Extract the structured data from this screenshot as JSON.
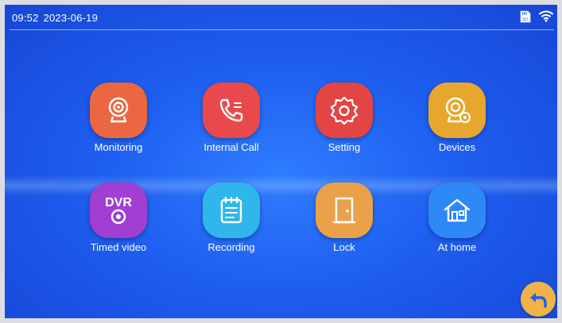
{
  "status": {
    "time": "09:52",
    "date": "2023-06-19",
    "icons": [
      "sd-card-icon",
      "wifi-icon"
    ]
  },
  "colors": {
    "screen_bg": "#1e5ff0",
    "monitoring": "#ea6742",
    "internal_call": "#e9494a",
    "setting": "#e34444",
    "devices": "#e6a72c",
    "timed_video": "#a03fd1",
    "recording": "#2fb6ea",
    "lock": "#e9a24a",
    "at_home": "#2e88f5",
    "back": "#f1b347"
  },
  "menu": [
    {
      "label": "Monitoring",
      "icon": "camera-icon"
    },
    {
      "label": "Internal Call",
      "icon": "phone-icon"
    },
    {
      "label": "Setting",
      "icon": "gear-icon"
    },
    {
      "label": "Devices",
      "icon": "device-camera-icon"
    },
    {
      "label": "Timed video",
      "icon": "dvr-icon",
      "badge": "DVR"
    },
    {
      "label": "Recording",
      "icon": "notebook-icon"
    },
    {
      "label": "Lock",
      "icon": "door-icon"
    },
    {
      "label": "At home",
      "icon": "house-icon"
    }
  ],
  "back_button": {
    "icon": "back-arrow-icon"
  }
}
